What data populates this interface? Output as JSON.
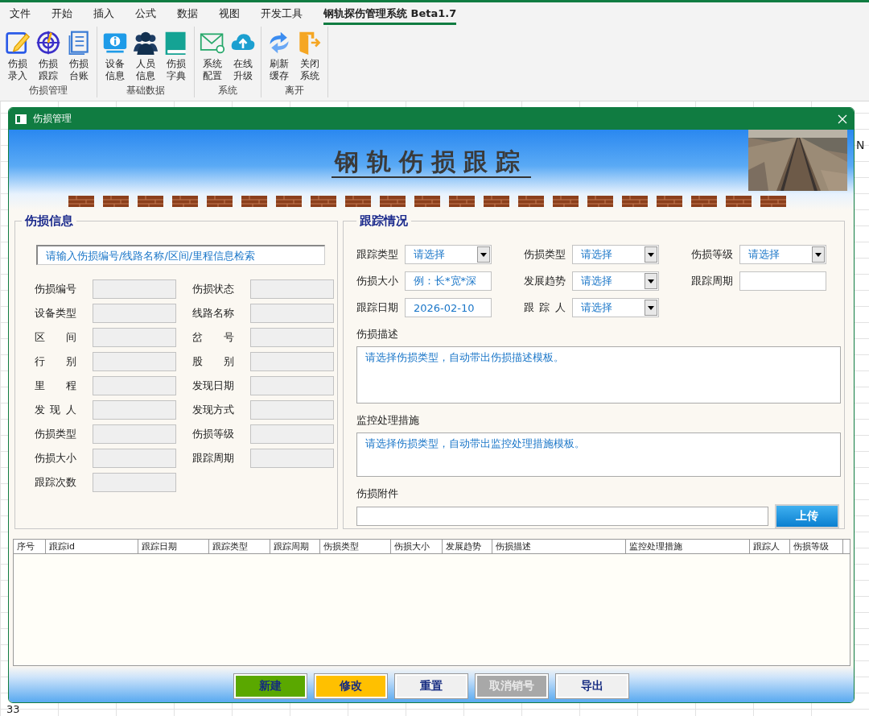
{
  "ribbon": {
    "tabs": [
      {
        "label": "文件",
        "selected": false
      },
      {
        "label": "开始",
        "selected": false
      },
      {
        "label": "插入",
        "selected": false
      },
      {
        "label": "公式",
        "selected": false
      },
      {
        "label": "数据",
        "selected": false
      },
      {
        "label": "视图",
        "selected": false
      },
      {
        "label": "开发工具",
        "selected": false
      },
      {
        "label": "钢轨探伤管理系统 Beta1.7",
        "selected": true
      }
    ],
    "groups": [
      {
        "label": "伤损管理",
        "buttons": [
          {
            "label": "伤损录入",
            "kind": "edit"
          },
          {
            "label": "伤损跟踪",
            "kind": "target"
          },
          {
            "label": "伤损台账",
            "kind": "ledger"
          }
        ]
      },
      {
        "label": "基础数据",
        "buttons": [
          {
            "label": "设备信息",
            "kind": "info"
          },
          {
            "label": "人员信息",
            "kind": "people"
          },
          {
            "label": "伤损字典",
            "kind": "book"
          }
        ]
      },
      {
        "label": "系统",
        "buttons": [
          {
            "label": "系统配置",
            "kind": "mail"
          },
          {
            "label": "在线升级",
            "kind": "cloud"
          }
        ]
      },
      {
        "label": "离开",
        "buttons": [
          {
            "label": "刷新缓存",
            "kind": "refresh"
          },
          {
            "label": "关闭系统",
            "kind": "exit"
          }
        ]
      }
    ]
  },
  "sheet": {
    "column_header": "N",
    "row_number": "33"
  },
  "dialog": {
    "title": "伤损管理",
    "banner_title": "钢轨伤损跟踪",
    "info_panel": {
      "title": "伤损信息",
      "search": {
        "placeholder": "请输入伤损编号/线路名称/区间/里程信息检索"
      },
      "fields": [
        {
          "label": "伤损编号"
        },
        {
          "label": "伤损状态"
        },
        {
          "label": "设备类型"
        },
        {
          "label": "线路名称"
        },
        {
          "label": "区 间"
        },
        {
          "label": "岔 号"
        },
        {
          "label": "行 别"
        },
        {
          "label": "股 别"
        },
        {
          "label": "里 程"
        },
        {
          "label": "发现日期"
        },
        {
          "label": "发 现 人"
        },
        {
          "label": "发现方式"
        },
        {
          "label": "伤损类型"
        },
        {
          "label": "伤损等级"
        },
        {
          "label": "伤损大小"
        },
        {
          "label": "跟踪周期"
        },
        {
          "label": "跟踪次数"
        }
      ]
    },
    "tracking_panel": {
      "title": "跟踪情况",
      "fields": [
        {
          "label": "跟踪类型",
          "kind": "select",
          "value": "请选择"
        },
        {
          "label": "伤损类型",
          "kind": "select",
          "value": "请选择"
        },
        {
          "label": "伤损等级",
          "kind": "select",
          "value": "请选择"
        },
        {
          "label": "伤损大小",
          "kind": "text",
          "value": "例：长*宽*深"
        },
        {
          "label": "发展趋势",
          "kind": "select",
          "value": "请选择"
        },
        {
          "label": "跟踪周期",
          "kind": "text"
        },
        {
          "label": "跟踪日期",
          "kind": "text",
          "value": "2026-02-10"
        },
        {
          "label": "跟 踪 人",
          "kind": "select",
          "value": "请选择"
        }
      ],
      "description": {
        "label": "伤损描述",
        "placeholder": "请选择伤损类型，自动带出伤损描述模板。"
      },
      "measures": {
        "label": "监控处理措施",
        "placeholder": "请选择伤损类型，自动带出监控处理措施模板。"
      },
      "attachment": {
        "label": "伤损附件",
        "button": "上传"
      }
    },
    "table": {
      "columns": [
        "序号",
        "跟踪id",
        "跟踪日期",
        "跟踪类型",
        "跟踪周期",
        "伤损类型",
        "伤损大小",
        "发展趋势",
        "伤损描述",
        "监控处理措施",
        "跟踪人",
        "伤损等级"
      ]
    },
    "buttons": [
      {
        "label": "新建",
        "color": "#5aa800",
        "disabled": false
      },
      {
        "label": "修改",
        "color": "#ffc000",
        "disabled": false
      },
      {
        "label": "重置",
        "color": "#f0f0f0",
        "disabled": false
      },
      {
        "label": "取消销号",
        "color": "#a8a8a8",
        "disabled": true
      },
      {
        "label": "导出",
        "color": "#f0f0f0",
        "disabled": false
      }
    ]
  }
}
